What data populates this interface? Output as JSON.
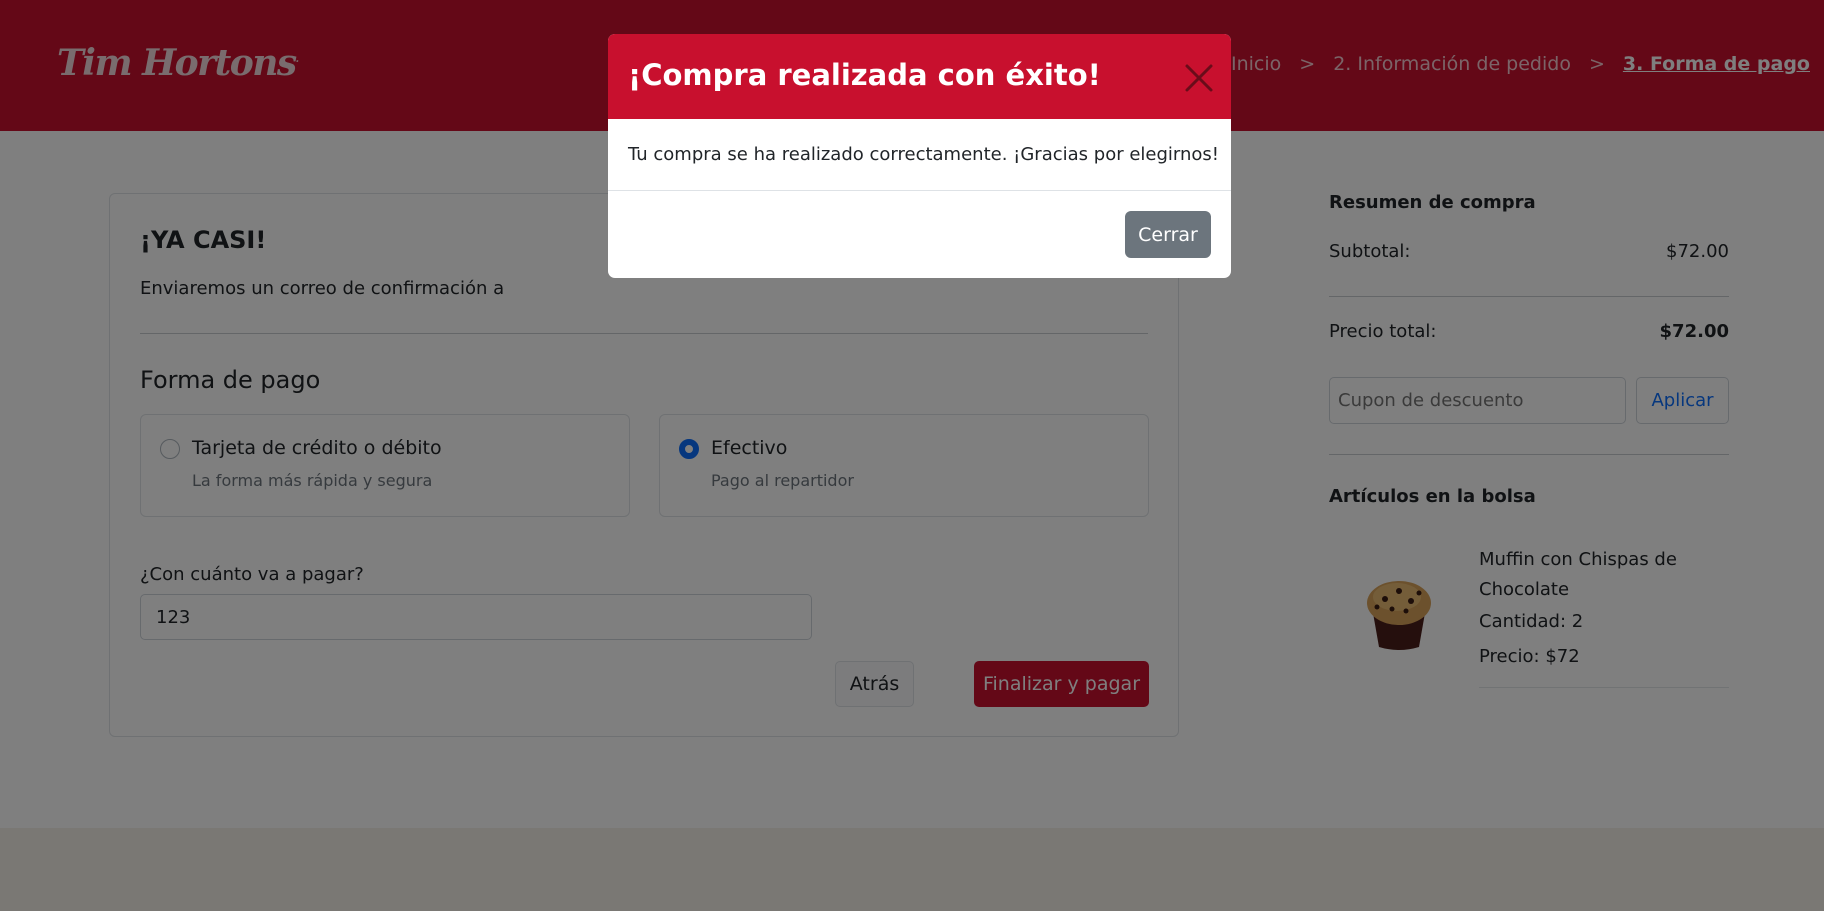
{
  "header": {
    "logo_text": "Tim Hortons",
    "breadcrumb": {
      "inicio": "Inicio",
      "sep1": ">",
      "step2": "2. Información de pedido",
      "sep2": ">",
      "step3": "3. Forma de pago"
    }
  },
  "checkout": {
    "title": "¡YA CASI!",
    "subtitle": "Enviaremos un correo de confirmación a",
    "payment_title": "Forma de pago",
    "options": [
      {
        "label": "Tarjeta de crédito o débito",
        "desc": "La forma más rápida y segura",
        "selected": false
      },
      {
        "label": "Efectivo",
        "desc": "Pago al repartidor",
        "selected": true
      }
    ],
    "amount_label": "¿Con cuánto va a pagar?",
    "amount_value": "123",
    "back_label": "Atrás",
    "finish_label": "Finalizar y pagar"
  },
  "summary": {
    "title": "Resumen de compra",
    "subtotal_label": "Subtotal:",
    "subtotal_value": "$72.00",
    "total_label": "Precio total:",
    "total_value": "$72.00",
    "coupon_placeholder": "Cupon de descuento",
    "coupon_button": "Aplicar",
    "bag_title": "Artículos en la bolsa",
    "items": [
      {
        "name": "Muffin con Chispas de Chocolate",
        "qty": "Cantidad: 2",
        "price": "Precio: $72"
      }
    ]
  },
  "modal": {
    "title": "¡Compra realizada con éxito!",
    "body": "Tu compra se ha realizado correctamente. ¡Gracias por elegirnos!",
    "close_button": "Cerrar"
  },
  "colors": {
    "brand_red": "#c8102e",
    "primary_blue": "#0d6efd",
    "secondary_gray": "#6c757d"
  }
}
